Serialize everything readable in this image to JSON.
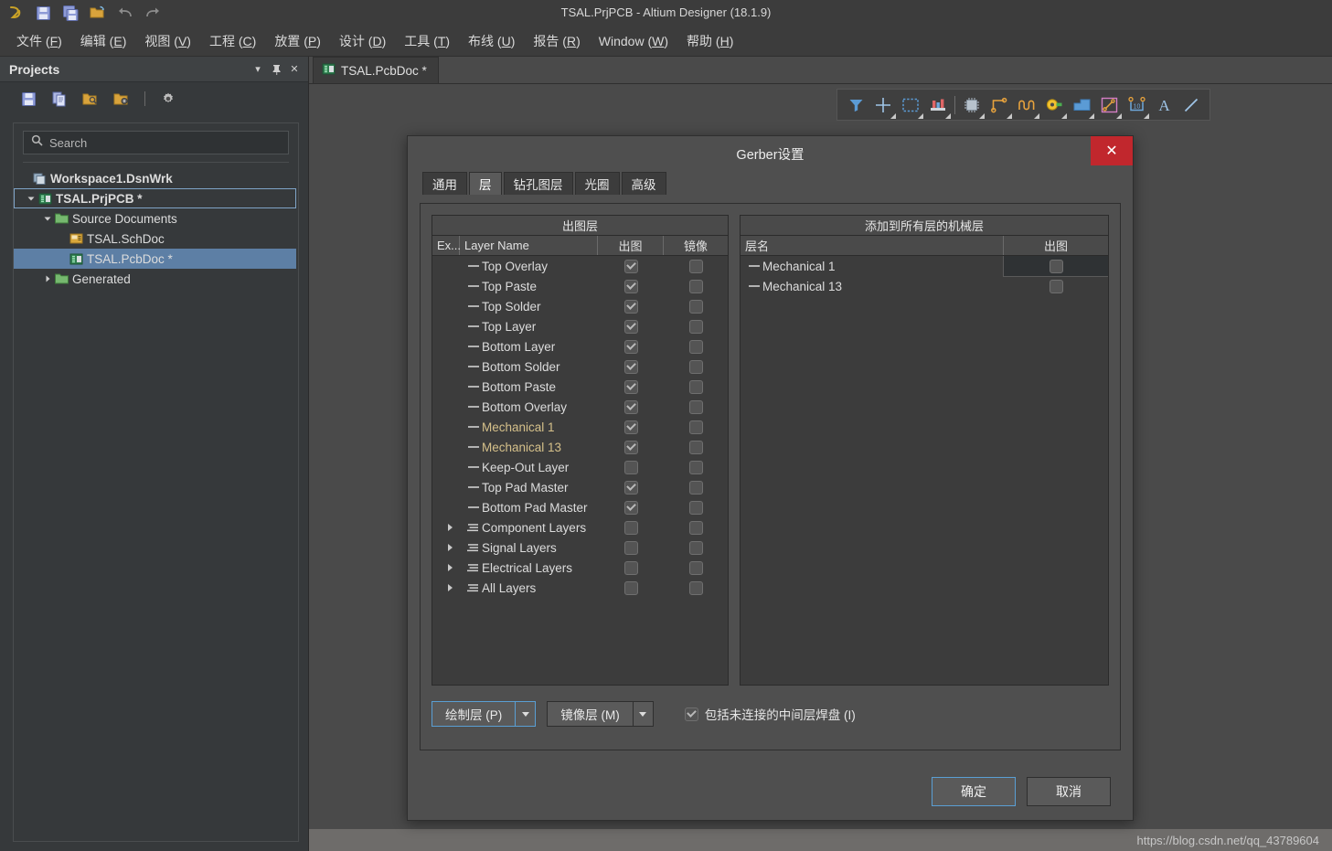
{
  "window": {
    "title": "TSAL.PrjPCB - Altium Designer (18.1.9)",
    "quick_access": [
      "altium-logo-icon",
      "save-icon",
      "save-all-icon",
      "open-icon",
      "undo-icon",
      "redo-icon"
    ]
  },
  "menubar": [
    {
      "label": "文件",
      "mnemonic": "F"
    },
    {
      "label": "编辑",
      "mnemonic": "E"
    },
    {
      "label": "视图",
      "mnemonic": "V"
    },
    {
      "label": "工程",
      "mnemonic": "C"
    },
    {
      "label": "放置",
      "mnemonic": "P"
    },
    {
      "label": "设计",
      "mnemonic": "D"
    },
    {
      "label": "工具",
      "mnemonic": "T"
    },
    {
      "label": "布线",
      "mnemonic": "U"
    },
    {
      "label": "报告",
      "mnemonic": "R"
    },
    {
      "label": "Window",
      "mnemonic": "W"
    },
    {
      "label": "帮助",
      "mnemonic": "H"
    }
  ],
  "projects_panel": {
    "title": "Projects",
    "header_buttons": [
      "chevron-down-icon",
      "pin-icon",
      "close-icon"
    ],
    "toolbar": [
      "save-icon",
      "documents-icon",
      "open-project-icon",
      "project-options-icon",
      "gear-icon"
    ],
    "search": {
      "placeholder": "Search",
      "value": ""
    },
    "tree": [
      {
        "label": "Workspace1.DsnWrk",
        "indent": 0,
        "icon": "workspace-icon",
        "twisty": "none",
        "bold": true,
        "selected": false
      },
      {
        "label": "TSAL.PrjPCB *",
        "indent": 1,
        "icon": "pcb-project-icon",
        "twisty": "down",
        "bold": true,
        "selected": false,
        "outlined": true
      },
      {
        "label": "Source Documents",
        "indent": 2,
        "icon": "folder-icon",
        "twisty": "down",
        "bold": false,
        "selected": false
      },
      {
        "label": "TSAL.SchDoc",
        "indent": 3,
        "icon": "schdoc-icon",
        "twisty": "none",
        "bold": false,
        "selected": false
      },
      {
        "label": "TSAL.PcbDoc *",
        "indent": 3,
        "icon": "pcbdoc-icon",
        "twisty": "none",
        "bold": false,
        "selected": true
      },
      {
        "label": "Generated",
        "indent": 2,
        "icon": "folder-icon",
        "twisty": "right",
        "bold": false,
        "selected": false
      }
    ]
  },
  "document_tabs": [
    {
      "label": "TSAL.PcbDoc *",
      "icon": "pcbdoc-icon",
      "active": true
    }
  ],
  "pcb_toolbar": [
    {
      "name": "filter-icon",
      "dropdown": false
    },
    {
      "name": "crosshair-icon",
      "dropdown": true
    },
    {
      "name": "selection-rect-icon",
      "dropdown": true
    },
    {
      "name": "layer-stack-icon",
      "dropdown": true
    },
    {
      "name": "separator",
      "dropdown": false
    },
    {
      "name": "component-icon",
      "dropdown": true
    },
    {
      "name": "route-track-icon",
      "dropdown": true
    },
    {
      "name": "meander-icon",
      "dropdown": true
    },
    {
      "name": "via-pad-icon",
      "dropdown": true
    },
    {
      "name": "polygon-pour-icon",
      "dropdown": true
    },
    {
      "name": "dimension-icon",
      "dropdown": true
    },
    {
      "name": "coordinate-icon",
      "dropdown": true
    },
    {
      "name": "text-string-icon",
      "dropdown": false
    },
    {
      "name": "line-icon",
      "dropdown": false
    }
  ],
  "dialog": {
    "title": "Gerber设置",
    "close_label": "✕",
    "tabs": [
      {
        "label": "通用",
        "active": false
      },
      {
        "label": "层",
        "active": true
      },
      {
        "label": "钻孔图层",
        "active": false
      },
      {
        "label": "光圈",
        "active": false
      },
      {
        "label": "高级",
        "active": false
      }
    ],
    "plot_layers_grid": {
      "caption": "出图层",
      "columns": [
        "Ex...",
        "Layer Name",
        "出图",
        "镜像"
      ],
      "rows": [
        {
          "name": "Top Overlay",
          "kind": "layer",
          "plot": true,
          "mirror": false,
          "tan": false
        },
        {
          "name": "Top Paste",
          "kind": "layer",
          "plot": true,
          "mirror": false,
          "tan": false
        },
        {
          "name": "Top Solder",
          "kind": "layer",
          "plot": true,
          "mirror": false,
          "tan": false
        },
        {
          "name": "Top Layer",
          "kind": "layer",
          "plot": true,
          "mirror": false,
          "tan": false
        },
        {
          "name": "Bottom Layer",
          "kind": "layer",
          "plot": true,
          "mirror": false,
          "tan": false
        },
        {
          "name": "Bottom Solder",
          "kind": "layer",
          "plot": true,
          "mirror": false,
          "tan": false
        },
        {
          "name": "Bottom Paste",
          "kind": "layer",
          "plot": true,
          "mirror": false,
          "tan": false
        },
        {
          "name": "Bottom Overlay",
          "kind": "layer",
          "plot": true,
          "mirror": false,
          "tan": false
        },
        {
          "name": "Mechanical 1",
          "kind": "layer",
          "plot": true,
          "mirror": false,
          "tan": true
        },
        {
          "name": "Mechanical 13",
          "kind": "layer",
          "plot": true,
          "mirror": false,
          "tan": true
        },
        {
          "name": "Keep-Out Layer",
          "kind": "layer",
          "plot": false,
          "mirror": false,
          "tan": false
        },
        {
          "name": "Top Pad Master",
          "kind": "layer",
          "plot": true,
          "mirror": false,
          "tan": false
        },
        {
          "name": "Bottom Pad Master",
          "kind": "layer",
          "plot": true,
          "mirror": false,
          "tan": false
        },
        {
          "name": "Component Layers",
          "kind": "group",
          "plot": false,
          "mirror": false,
          "tan": false
        },
        {
          "name": "Signal Layers",
          "kind": "group",
          "plot": false,
          "mirror": false,
          "tan": false
        },
        {
          "name": "Electrical Layers",
          "kind": "group",
          "plot": false,
          "mirror": false,
          "tan": false
        },
        {
          "name": "All Layers",
          "kind": "group",
          "plot": false,
          "mirror": false,
          "tan": false
        }
      ]
    },
    "mechanical_grid": {
      "caption": "添加到所有层的机械层",
      "columns": [
        "层名",
        "出图"
      ],
      "rows": [
        {
          "name": "Mechanical 1",
          "plot": false,
          "focused": true
        },
        {
          "name": "Mechanical 13",
          "plot": false,
          "focused": false
        }
      ]
    },
    "controls": {
      "plot_layers_button": {
        "label": "绘制层 (P)",
        "focused": true
      },
      "mirror_layers_button": {
        "label": "镜像层 (M)",
        "focused": false
      },
      "include_unconnected": {
        "label": "包括未连接的中间层焊盘 (I)",
        "checked": true
      }
    },
    "footer": {
      "ok_label": "确定",
      "cancel_label": "取消"
    }
  },
  "watermark": "https://blog.csdn.net/qq_43789604",
  "colors": {
    "accent": "#5a9fd4",
    "close_red": "#c1272d",
    "selection_blue": "#5d7fa5",
    "mechanical_tan": "#d5c08a",
    "window_bg": "#4a4a4a"
  }
}
